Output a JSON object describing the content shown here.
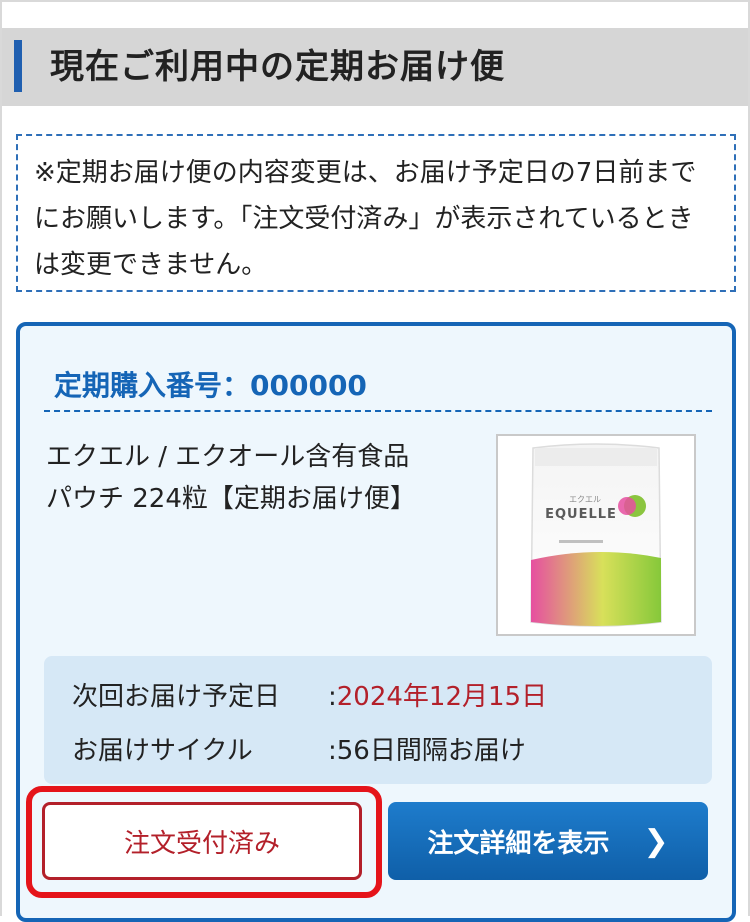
{
  "section": {
    "title": "現在ご利用中の定期お届け便"
  },
  "notice": {
    "text": "※定期お届け便の内容変更は、お届け予定日の7日前までにお願いします。「注文受付済み」が表示されているときは変更できません。"
  },
  "subscription": {
    "order_label": "定期購入番号：",
    "order_number": "000000",
    "product_line1": "エクエル / エクオール含有食品",
    "product_line2": "パウチ 224粒【定期お届け便】",
    "package_brand": "EQUELLE",
    "package_kana": "エクエル",
    "next_delivery_label": "次回お届け予定日",
    "next_delivery_value": "2024年12月15日",
    "cycle_label": "お届けサイクル",
    "cycle_value": "56日間隔お届け",
    "separator": ":"
  },
  "buttons": {
    "received": "注文受付済み",
    "detail": "注文詳細を表示"
  },
  "colors": {
    "accent_blue": "#1565b6",
    "alert_red": "#e5141a",
    "date_red": "#b3202a"
  }
}
